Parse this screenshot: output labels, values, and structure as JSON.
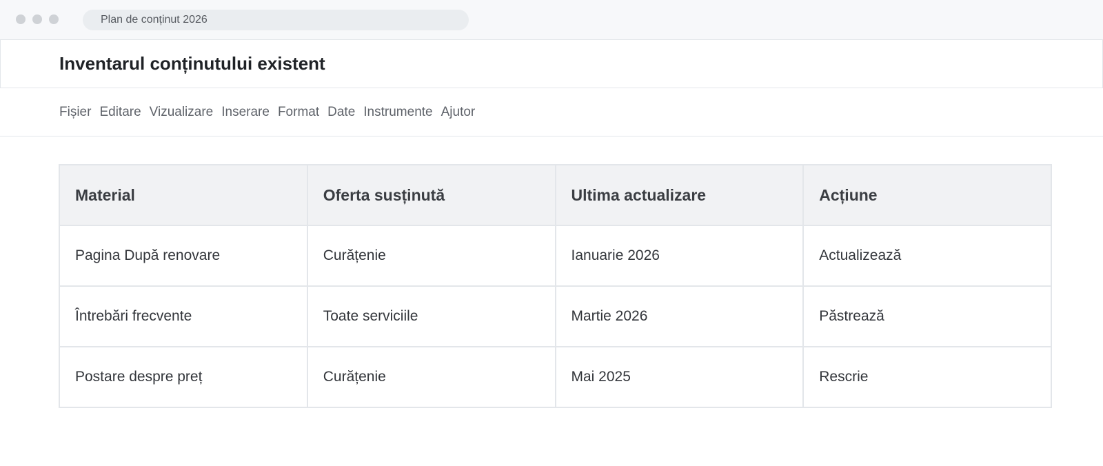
{
  "browser": {
    "address": "Plan de conținut 2026"
  },
  "document": {
    "title": "Inventarul conținutului existent"
  },
  "menu": [
    {
      "label": "Fișier"
    },
    {
      "label": "Editare"
    },
    {
      "label": "Vizualizare"
    },
    {
      "label": "Inserare"
    },
    {
      "label": "Format"
    },
    {
      "label": "Date"
    },
    {
      "label": "Instrumente"
    },
    {
      "label": "Ajutor"
    }
  ],
  "table": {
    "headers": [
      "Material",
      "Oferta susținută",
      "Ultima actualizare",
      "Acțiune"
    ],
    "rows": [
      [
        "Pagina După renovare",
        "Curățenie",
        "Ianuarie 2026",
        "Actualizează"
      ],
      [
        "Întrebări frecvente",
        "Toate serviciile",
        "Martie 2026",
        "Păstrează"
      ],
      [
        "Postare despre preț",
        "Curățenie",
        "Mai 2025",
        "Rescrie"
      ]
    ]
  }
}
